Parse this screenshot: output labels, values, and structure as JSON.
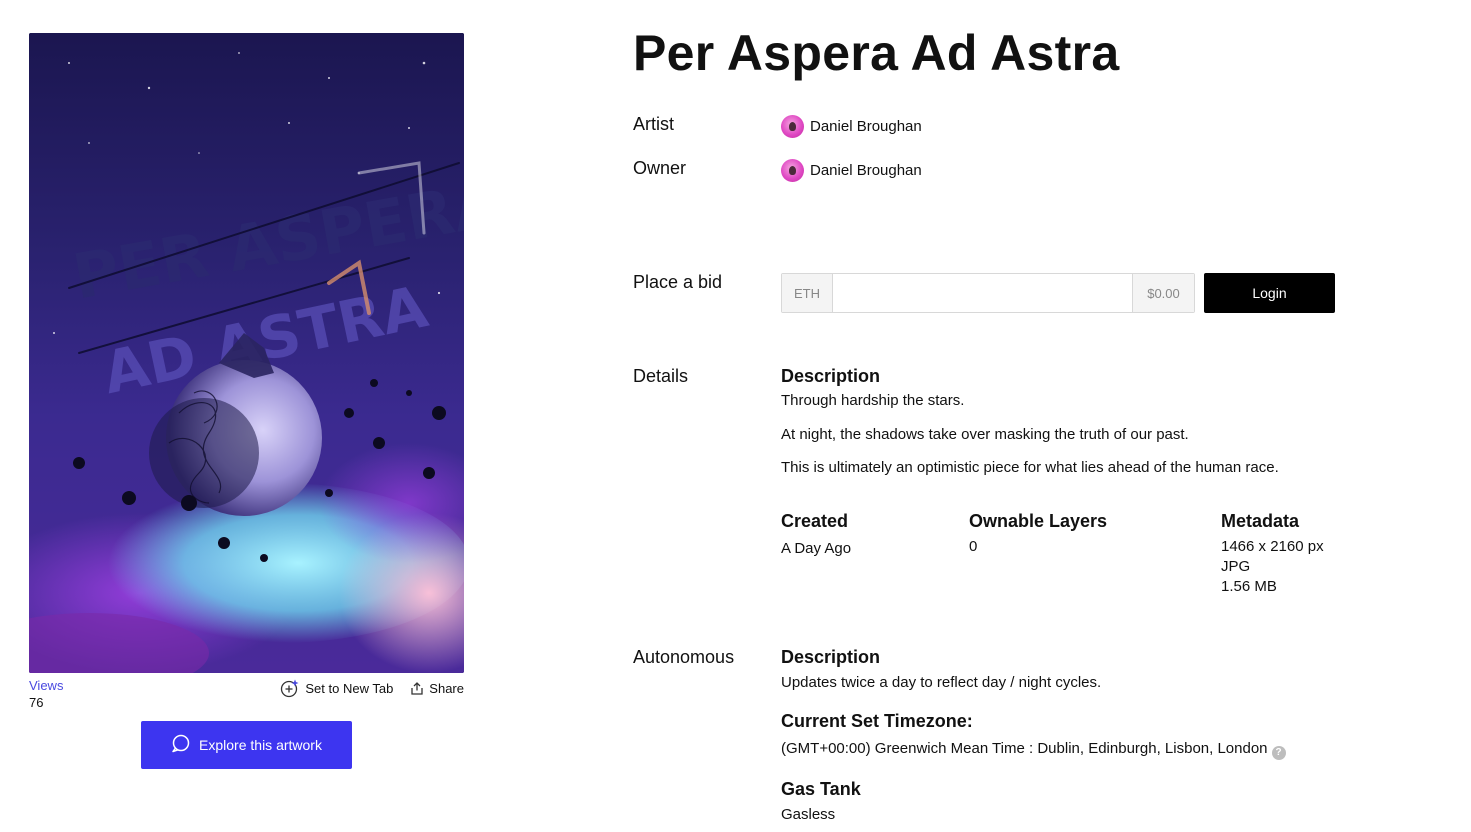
{
  "artwork": {
    "painted_text_line1": "PER ASPERA",
    "painted_text_line2": "AD ASTRA",
    "colors": {
      "sky_top": "#1b1650",
      "sky_mid": "#3a2a8c",
      "nebula_cyan": "#7ee0f0",
      "nebula_pink": "#f3a6d2",
      "nebula_purple": "#8a3fd0",
      "orb": "#b9b2ea"
    }
  },
  "views": {
    "label": "Views",
    "count": "76"
  },
  "actions": {
    "set_new_tab": {
      "label": "Set to New Tab",
      "icon": "add-tab-icon"
    },
    "share": {
      "label": "Share",
      "icon": "share-icon"
    }
  },
  "explore": {
    "label": "Explore this artwork",
    "icon": "chat-bubble-icon"
  },
  "title": "Per Aspera Ad Astra",
  "artist": {
    "label": "Artist",
    "name": "Daniel Broughan"
  },
  "owner": {
    "label": "Owner",
    "name": "Daniel Broughan"
  },
  "bid": {
    "label": "Place a bid",
    "currency": "ETH",
    "value": "",
    "usd": "$0.00",
    "login_label": "Login"
  },
  "details": {
    "label": "Details",
    "description_heading": "Description",
    "description_lines": [
      "Through hardship the stars.",
      "At night, the shadows take over masking the truth of our past.",
      "This is ultimately an optimistic piece for what lies ahead of the human race."
    ],
    "created": {
      "heading": "Created",
      "value": "A Day Ago"
    },
    "ownable_layers": {
      "heading": "Ownable Layers",
      "value": "0"
    },
    "metadata": {
      "heading": "Metadata",
      "dimensions": "1466 x 2160 px",
      "format": "JPG",
      "size": "1.56 MB"
    }
  },
  "autonomous": {
    "label": "Autonomous",
    "description_heading": "Description",
    "description": "Updates twice a day to reflect day / night cycles.",
    "timezone_heading": "Current Set Timezone:",
    "timezone": "(GMT+00:00) Greenwich Mean Time : Dublin, Edinburgh, Lisbon, London",
    "help_glyph": "?",
    "gas_heading": "Gas Tank",
    "gas_value": "Gasless"
  },
  "accent_color": "#3d35f0"
}
